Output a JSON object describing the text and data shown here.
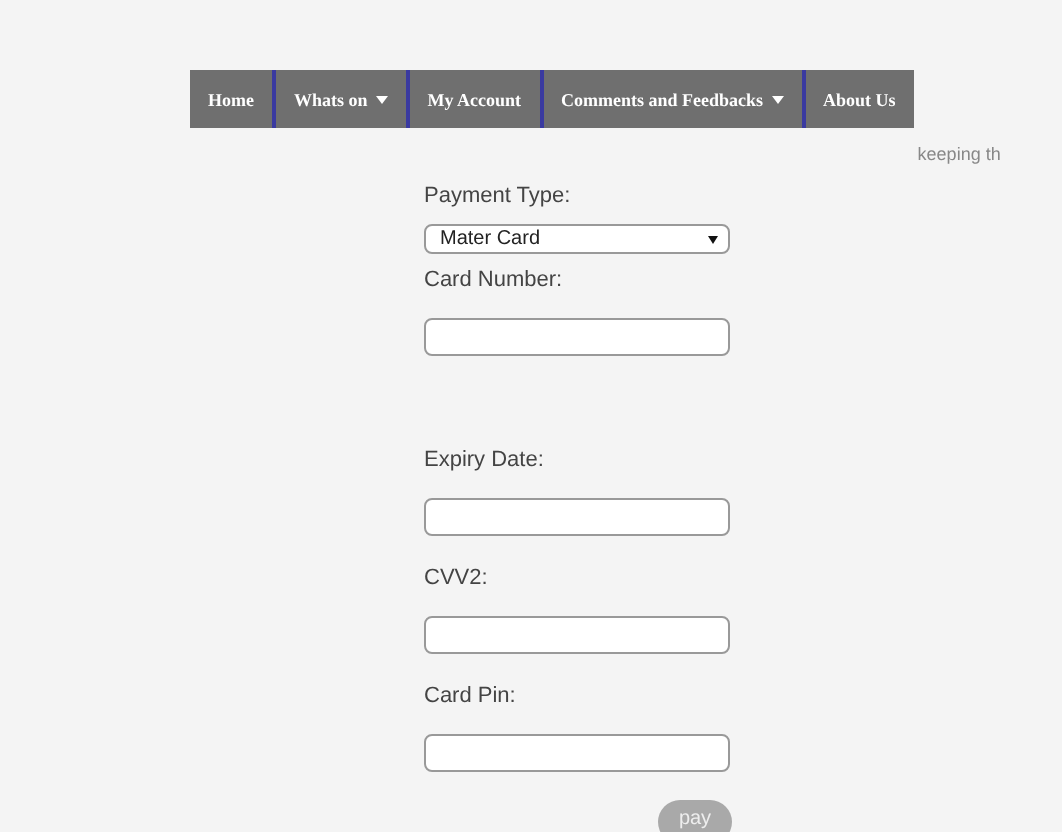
{
  "nav": {
    "items": [
      {
        "label": "Home",
        "dropdown": false
      },
      {
        "label": "Whats on",
        "dropdown": true
      },
      {
        "label": "My Account",
        "dropdown": false
      },
      {
        "label": "Comments and Feedbacks",
        "dropdown": true
      },
      {
        "label": "About Us",
        "dropdown": false
      }
    ],
    "tagline": "keeping th"
  },
  "form": {
    "fields": [
      {
        "kind": "select",
        "label": "Payment Type:",
        "value": "Mater Card"
      },
      {
        "kind": "input",
        "label": "Card Number:"
      },
      {
        "kind": "input",
        "label": "Expiry Date:"
      },
      {
        "kind": "input",
        "label": "CVV2:"
      },
      {
        "kind": "input",
        "label": "Card Pin:"
      }
    ],
    "submit": "pay"
  }
}
